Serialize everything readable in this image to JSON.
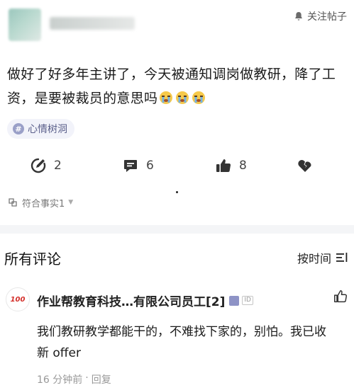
{
  "post": {
    "follow_label": "关注帖子",
    "text": "做好了好多年主讲了，今天被通知调岗做教研，降了工资，是要被裁员的意思吗",
    "emoji_count": 3,
    "tag": "心情树洞",
    "actions": {
      "comment_count": "2",
      "reply_count": "6",
      "like_count": "8"
    },
    "fact_label": "符合事实1"
  },
  "comments": {
    "title": "所有评论",
    "sort_label": "按时间",
    "items": [
      {
        "avatar_text": "100",
        "author": "作业帮教育科技…有限公司员工[2]",
        "id_badge": "ID",
        "body": "我们教研教学都能干的，不难找下家的，别怕。我已收新 offer",
        "time": "16 分钟前",
        "separator": "·",
        "reply_label": "回复"
      }
    ]
  },
  "colors": {
    "accent": "#5a5f8a",
    "tag_bg": "#f2f3fa",
    "verified": "#8e93c6",
    "avatar_brand": "#d4302b"
  }
}
